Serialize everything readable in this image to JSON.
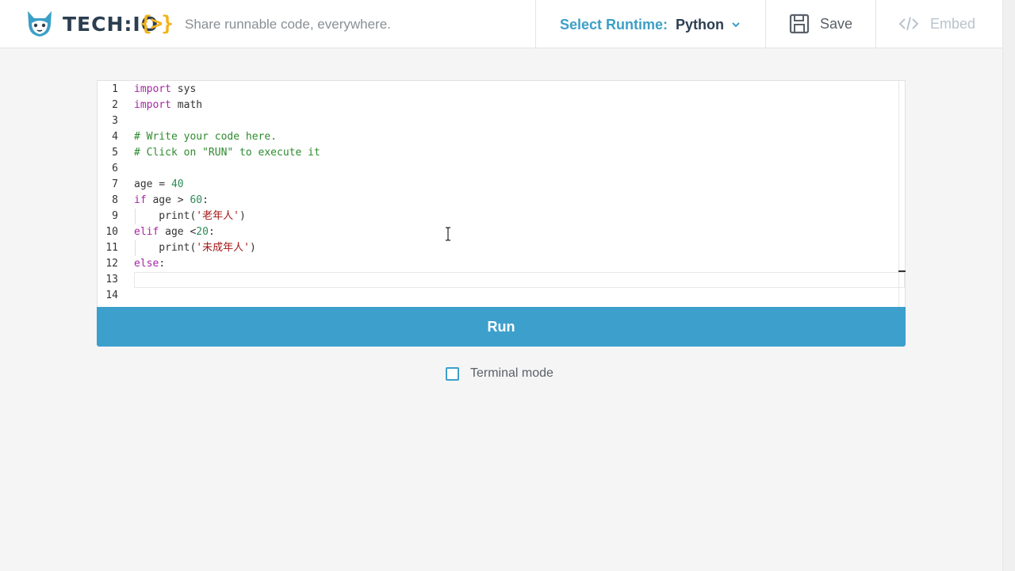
{
  "header": {
    "brand": "TECH:IO",
    "brand_brackets": "{>}",
    "tagline": "Share runnable code, everywhere.",
    "runtime_label": "Select Runtime:",
    "runtime_value": "Python",
    "save_label": "Save",
    "embed_label": "Embed",
    "accent_color": "#3c9fc7",
    "brand_color": "#f2b21b"
  },
  "editor": {
    "lines": [
      {
        "n": "1"
      },
      {
        "n": "2"
      },
      {
        "n": "3"
      },
      {
        "n": "4"
      },
      {
        "n": "5"
      },
      {
        "n": "6"
      },
      {
        "n": "7"
      },
      {
        "n": "8"
      },
      {
        "n": "9"
      },
      {
        "n": "10"
      },
      {
        "n": "11"
      },
      {
        "n": "12"
      },
      {
        "n": "13"
      },
      {
        "n": "14"
      }
    ],
    "code": {
      "l1_kw": "import",
      "l1_rest": " sys",
      "l2_kw": "import",
      "l2_rest": " math",
      "l4": "# Write your code here.",
      "l5": "# Click on \"RUN\" to execute it",
      "l7_a": "age = ",
      "l7_num": "40",
      "l8_kw": "if",
      "l8_a": " age > ",
      "l8_num": "60",
      "l8_b": ":",
      "l9_a": "    print(",
      "l9_str": "'老年人'",
      "l9_b": ")",
      "l10_kw": "elif",
      "l10_a": " age <",
      "l10_num": "20",
      "l10_b": ":",
      "l11_a": "    print(",
      "l11_str": "'未成年人'",
      "l11_b": ")",
      "l12_kw": "else",
      "l12_b": ":"
    }
  },
  "run_label": "Run",
  "terminal_mode": {
    "label": "Terminal mode",
    "checked": false
  }
}
